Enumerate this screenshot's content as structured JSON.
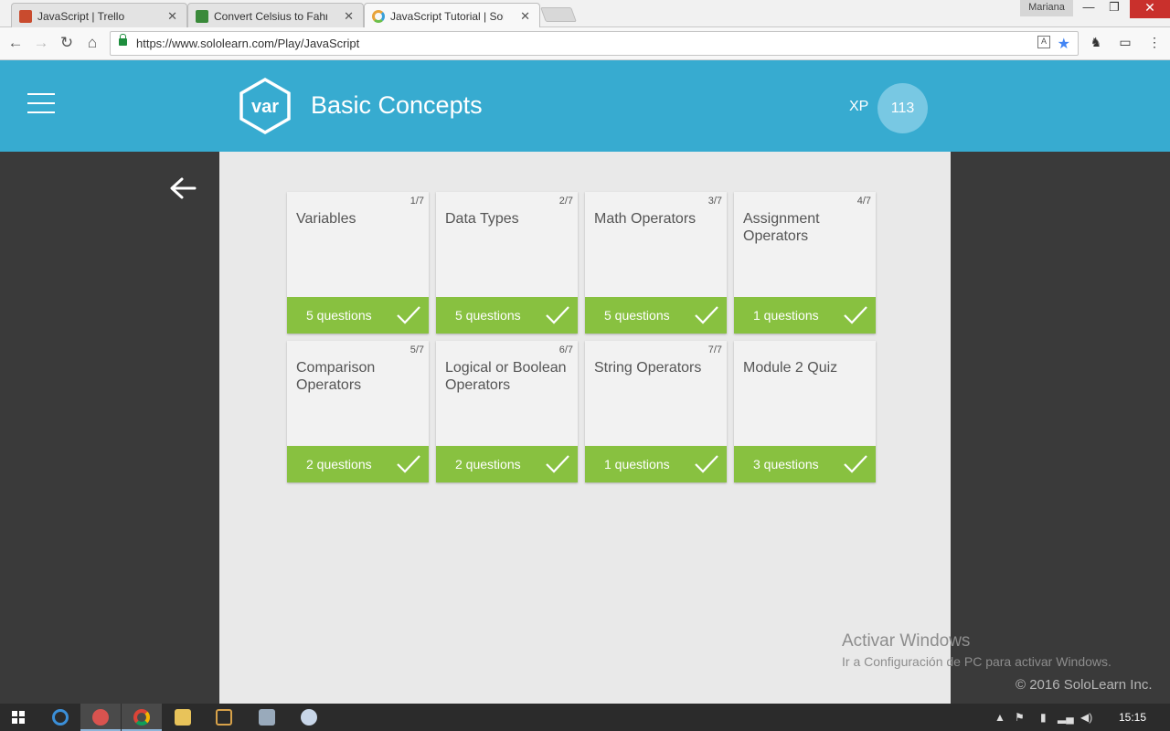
{
  "browser": {
    "tabs": [
      {
        "title": "JavaScript | Trello",
        "close": "✕"
      },
      {
        "title": "Convert Celsius to Fahrenh",
        "close": "✕"
      },
      {
        "title": "JavaScript Tutorial | SoloL",
        "close": "✕"
      }
    ],
    "user": "Mariana",
    "url": "https://www.sololearn.com/Play/JavaScript"
  },
  "header": {
    "logo_text": "var",
    "title": "Basic Concepts",
    "xp_label": "XP",
    "xp_value": "113"
  },
  "lessons": [
    {
      "number": "1/7",
      "name": "Variables",
      "questions": "5 questions"
    },
    {
      "number": "2/7",
      "name": "Data Types",
      "questions": "5 questions"
    },
    {
      "number": "3/7",
      "name": "Math Operators",
      "questions": "5 questions"
    },
    {
      "number": "4/7",
      "name": "Assignment Operators",
      "questions": "1 questions"
    },
    {
      "number": "5/7",
      "name": "Comparison Operators",
      "questions": "2 questions"
    },
    {
      "number": "6/7",
      "name": "Logical or Boolean Operators",
      "questions": "2 questions"
    },
    {
      "number": "7/7",
      "name": "String Operators",
      "questions": "1 questions"
    },
    {
      "number": "",
      "name": "Module 2 Quiz",
      "questions": "3 questions"
    }
  ],
  "watermark": {
    "line1": "Activar Windows",
    "line2": "Ir a Configuración de PC para activar Windows."
  },
  "footer": {
    "copyright": "© 2016 SoloLearn Inc."
  },
  "taskbar": {
    "time": "15:15"
  },
  "colors": {
    "header": "#37abd0",
    "complete": "#88c140",
    "card": "#f2f2f2"
  }
}
